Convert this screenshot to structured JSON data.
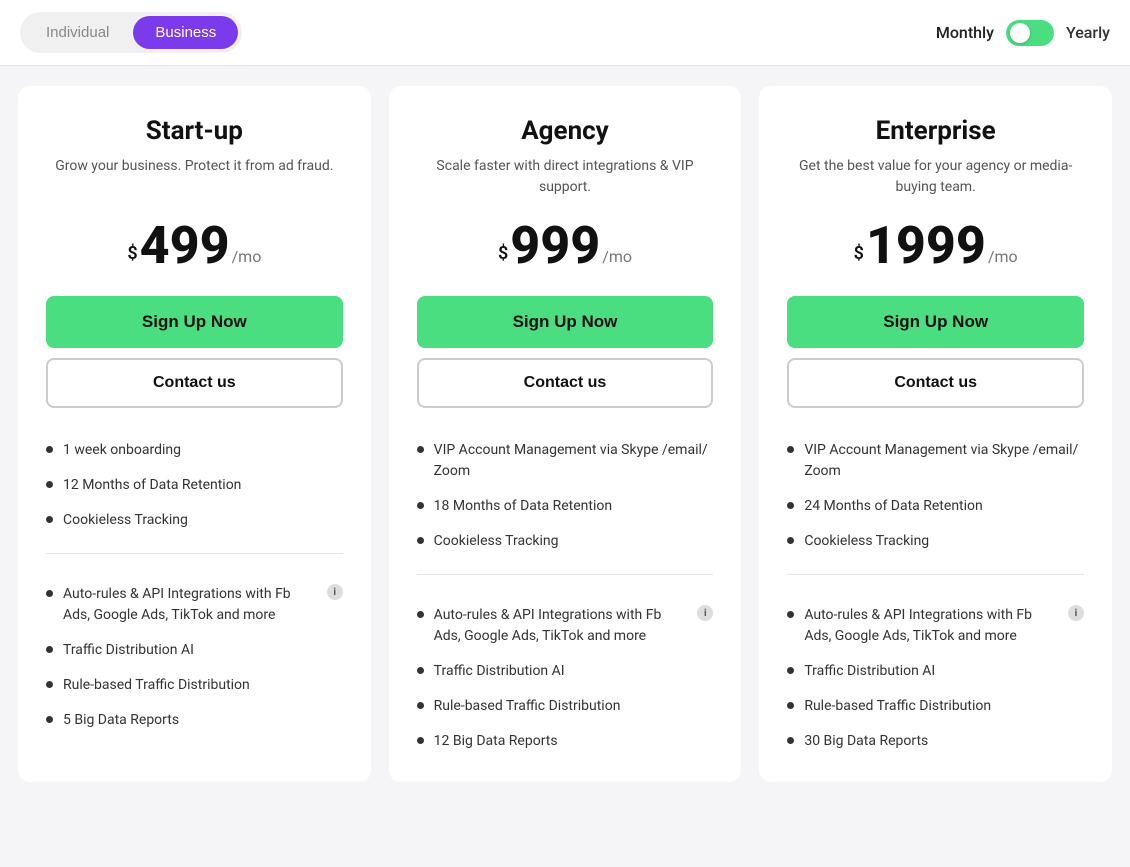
{
  "topBar": {
    "planToggle": {
      "individual": "Individual",
      "business": "Business",
      "activeTab": "Business"
    },
    "billingToggle": {
      "monthly": "Monthly",
      "yearly": "Yearly",
      "activeState": "Monthly"
    }
  },
  "plans": [
    {
      "id": "startup",
      "name": "Start-up",
      "description": "Grow your business. Protect it from ad fraud.",
      "price": "499",
      "period": "/mo",
      "currencySymbol": "$",
      "signupLabel": "Sign Up Now",
      "contactLabel": "Contact us",
      "features": [
        {
          "text": "1 week onboarding",
          "hasInfo": false
        },
        {
          "text": "12 Months of Data Retention",
          "hasInfo": false
        },
        {
          "text": "Cookieless Tracking",
          "hasInfo": false
        }
      ],
      "extraFeatures": [
        {
          "text": "Auto-rules & API Integrations with Fb Ads, Google Ads, TikTok and more",
          "hasInfo": true
        },
        {
          "text": "Traffic Distribution AI",
          "hasInfo": false
        },
        {
          "text": "Rule-based Traffic Distribution",
          "hasInfo": false
        },
        {
          "text": "5 Big Data Reports",
          "hasInfo": false
        }
      ]
    },
    {
      "id": "agency",
      "name": "Agency",
      "description": "Scale faster with direct integrations & VIP support.",
      "price": "999",
      "period": "/mo",
      "currencySymbol": "$",
      "signupLabel": "Sign Up Now",
      "contactLabel": "Contact us",
      "features": [
        {
          "text": "VIP Account Management via Skype /email/ Zoom",
          "hasInfo": false
        },
        {
          "text": "18 Months of Data Retention",
          "hasInfo": false
        },
        {
          "text": "Cookieless Tracking",
          "hasInfo": false
        }
      ],
      "extraFeatures": [
        {
          "text": "Auto-rules & API Integrations with Fb Ads, Google Ads, TikTok and more",
          "hasInfo": true
        },
        {
          "text": "Traffic Distribution AI",
          "hasInfo": false
        },
        {
          "text": "Rule-based Traffic Distribution",
          "hasInfo": false
        },
        {
          "text": "12 Big Data Reports",
          "hasInfo": false
        }
      ]
    },
    {
      "id": "enterprise",
      "name": "Enterprise",
      "description": "Get the best value for your agency or media-buying team.",
      "price": "1999",
      "period": "/mo",
      "currencySymbol": "$",
      "signupLabel": "Sign Up Now",
      "contactLabel": "Contact us",
      "features": [
        {
          "text": "VIP Account Management via Skype /email/ Zoom",
          "hasInfo": false
        },
        {
          "text": "24 Months of Data Retention",
          "hasInfo": false
        },
        {
          "text": "Cookieless Tracking",
          "hasInfo": false
        }
      ],
      "extraFeatures": [
        {
          "text": "Auto-rules & API Integrations with Fb Ads, Google Ads, TikTok and more",
          "hasInfo": true
        },
        {
          "text": "Traffic Distribution AI",
          "hasInfo": false
        },
        {
          "text": "Rule-based Traffic Distribution",
          "hasInfo": false
        },
        {
          "text": "30 Big Data Reports",
          "hasInfo": false
        }
      ]
    }
  ]
}
